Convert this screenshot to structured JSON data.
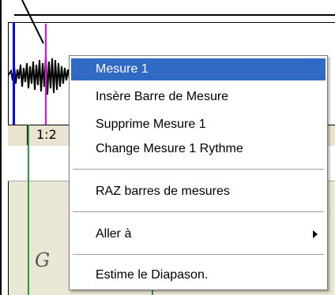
{
  "timeline": {
    "measure_label": "1:2"
  },
  "staff": {
    "note_letter": "G"
  },
  "context_menu": {
    "items": [
      {
        "label": "Mesure 1",
        "selected": true
      },
      {
        "label": "Insère Barre de Mesure"
      },
      {
        "label": "Supprime Mesure 1"
      },
      {
        "label": "Change Mesure 1 Rythme"
      },
      {
        "label": "RAZ barres de mesures"
      },
      {
        "label": "Aller à",
        "has_submenu": true
      },
      {
        "label": "Estime le Diapason."
      }
    ]
  },
  "colors": {
    "selection": "#316ac5",
    "marker_blue": "#0000ff",
    "marker_pink": "#ff00ff",
    "beat_line": "#2e9a3e",
    "panel_bg": "#ebe7d5"
  },
  "icons": [
    "submenu-arrow-icon"
  ]
}
